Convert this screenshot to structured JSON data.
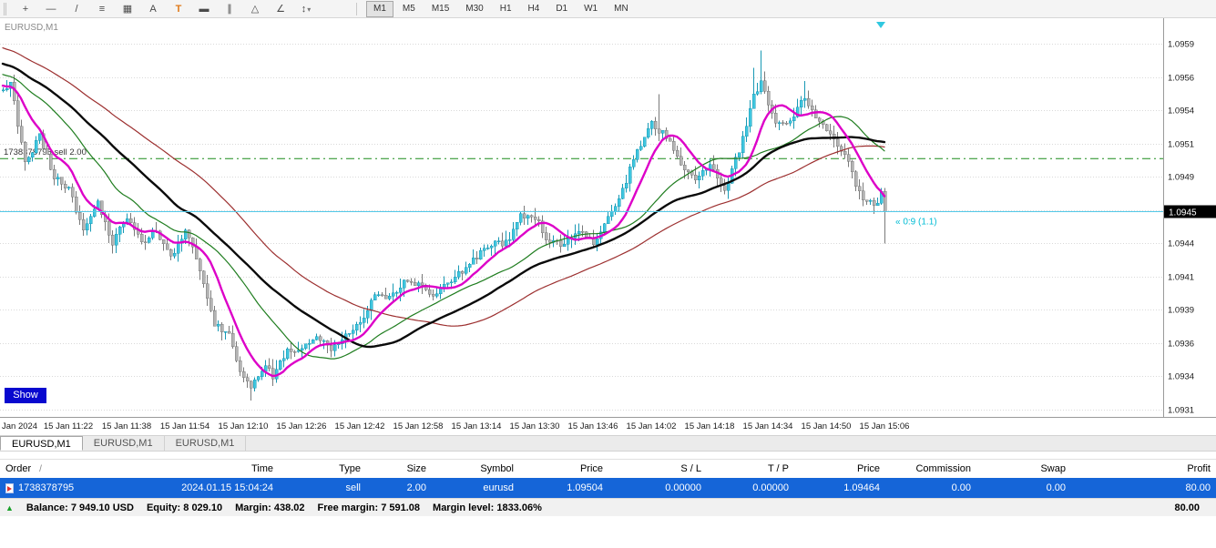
{
  "toolbar": {
    "tools": [
      {
        "name": "crosshair",
        "glyph": "+"
      },
      {
        "name": "horizontal-line",
        "glyph": "—"
      },
      {
        "name": "trendline",
        "glyph": "/"
      },
      {
        "name": "fibonacci",
        "glyph": "≡"
      },
      {
        "name": "grid",
        "glyph": "▦"
      },
      {
        "name": "text",
        "glyph": "A"
      },
      {
        "name": "text-label",
        "glyph": "T"
      },
      {
        "name": "rectangle",
        "glyph": "▬"
      },
      {
        "name": "equidistant-channel",
        "glyph": "∥"
      },
      {
        "name": "triangle",
        "glyph": "△"
      },
      {
        "name": "angle",
        "glyph": "∠"
      },
      {
        "name": "arrows",
        "glyph": "↕"
      }
    ],
    "dropdown_caret": "▾",
    "timeframes": [
      "M1",
      "M5",
      "M15",
      "M30",
      "H1",
      "H4",
      "D1",
      "W1",
      "MN"
    ],
    "active_timeframe": "M1"
  },
  "chart_data": {
    "type": "candlestick",
    "symbol": "EURUSD",
    "timeframe": "M1",
    "symbol_label": "EURUSD,M1",
    "show_button": "Show",
    "y_axis": {
      "values": [
        1.0959,
        1.09565,
        1.0954,
        1.09515,
        1.0949,
        1.09465,
        1.0944,
        1.09415,
        1.0939,
        1.09365,
        1.0934,
        1.09315
      ],
      "labels": [
        "1.0959",
        "1.0956",
        "1.0954",
        "1.0951",
        "1.0949",
        "1.0946",
        "1.0944",
        "1.0941",
        "1.0939",
        "1.0936",
        "1.0934",
        "1.0931"
      ]
    },
    "x_axis": {
      "labels": [
        {
          "m": 0,
          "text": "Jan 2024"
        },
        {
          "m": 18,
          "text": "15 Jan 11:22"
        },
        {
          "m": 34,
          "text": "15 Jan 11:38"
        },
        {
          "m": 50,
          "text": "15 Jan 11:54"
        },
        {
          "m": 66,
          "text": "15 Jan 12:10"
        },
        {
          "m": 82,
          "text": "15 Jan 12:26"
        },
        {
          "m": 98,
          "text": "15 Jan 12:42"
        },
        {
          "m": 114,
          "text": "15 Jan 12:58"
        },
        {
          "m": 130,
          "text": "15 Jan 13:14"
        },
        {
          "m": 146,
          "text": "15 Jan 13:30"
        },
        {
          "m": 162,
          "text": "15 Jan 13:46"
        },
        {
          "m": 178,
          "text": "15 Jan 14:02"
        },
        {
          "m": 194,
          "text": "15 Jan 14:18"
        },
        {
          "m": 210,
          "text": "15 Jan 14:34"
        },
        {
          "m": 226,
          "text": "15 Jan 14:50"
        },
        {
          "m": 242,
          "text": "15 Jan 15:06"
        }
      ]
    },
    "candle_count": 243,
    "price_path": [
      [
        0,
        1.09555
      ],
      [
        2,
        1.0956
      ],
      [
        6,
        1.095
      ],
      [
        10,
        1.0952
      ],
      [
        14,
        1.0949
      ],
      [
        18,
        1.0948
      ],
      [
        22,
        1.0945
      ],
      [
        26,
        1.0947
      ],
      [
        30,
        1.0944
      ],
      [
        34,
        1.0946
      ],
      [
        38,
        1.0944
      ],
      [
        42,
        1.0945
      ],
      [
        46,
        1.0943
      ],
      [
        50,
        1.0945
      ],
      [
        54,
        1.0942
      ],
      [
        58,
        1.0938
      ],
      [
        62,
        1.0937
      ],
      [
        64,
        1.0935
      ],
      [
        68,
        1.0933
      ],
      [
        72,
        1.0935
      ],
      [
        74,
        1.0934
      ],
      [
        78,
        1.0936
      ],
      [
        82,
        1.0936
      ],
      [
        86,
        1.0937
      ],
      [
        90,
        1.0936
      ],
      [
        94,
        1.0937
      ],
      [
        98,
        1.0938
      ],
      [
        102,
        1.094
      ],
      [
        106,
        1.094
      ],
      [
        110,
        1.0941
      ],
      [
        114,
        1.0941
      ],
      [
        118,
        1.094
      ],
      [
        122,
        1.0941
      ],
      [
        126,
        1.0942
      ],
      [
        130,
        1.0943
      ],
      [
        134,
        1.0944
      ],
      [
        138,
        1.0944
      ],
      [
        142,
        1.0946
      ],
      [
        146,
        1.0946
      ],
      [
        150,
        1.0944
      ],
      [
        154,
        1.0944
      ],
      [
        158,
        1.0945
      ],
      [
        162,
        1.0944
      ],
      [
        166,
        1.0946
      ],
      [
        170,
        1.0948
      ],
      [
        174,
        1.0951
      ],
      [
        178,
        1.0953
      ],
      [
        182,
        1.0952
      ],
      [
        186,
        1.095
      ],
      [
        190,
        1.0949
      ],
      [
        194,
        1.095
      ],
      [
        198,
        1.0948
      ],
      [
        202,
        1.0951
      ],
      [
        206,
        1.0955
      ],
      [
        208,
        1.0956
      ],
      [
        212,
        1.0953
      ],
      [
        216,
        1.0953
      ],
      [
        220,
        1.0955
      ],
      [
        224,
        1.0953
      ],
      [
        228,
        1.0952
      ],
      [
        232,
        1.095
      ],
      [
        236,
        1.0947
      ],
      [
        240,
        1.0947
      ],
      [
        241,
        1.0948
      ],
      [
        242,
        1.09464
      ]
    ],
    "overrides": [
      {
        "i": 68,
        "low": 1.09322
      },
      {
        "i": 180,
        "high": 1.09552
      },
      {
        "i": 206,
        "high": 1.09572
      },
      {
        "i": 208,
        "high": 1.09585
      },
      {
        "i": 220,
        "high": 1.09562
      },
      {
        "i": 242,
        "close": 1.09464,
        "low": 1.0944
      }
    ],
    "moving_averages": [
      {
        "name": "ma-slowest-red",
        "period": 70,
        "color": "#9c2f2f",
        "width": 1.2
      },
      {
        "name": "ma-slow-green",
        "period": 28,
        "color": "#1f7d1f",
        "width": 1.2
      },
      {
        "name": "ma-mid-black",
        "period": 45,
        "color": "#0a0a0a",
        "width": 2.4
      },
      {
        "name": "ma-fast-magenta",
        "period": 10,
        "color": "#dd00c8",
        "width": 2.4
      }
    ],
    "sell_line": {
      "price": 1.09504,
      "label": "1738378795 sell 2.00"
    },
    "bid": {
      "price": 1.09464,
      "tag": "1.0945"
    },
    "annotation": {
      "text": "« 0:9 (1.1)"
    },
    "colors": {
      "background": "#ffffff",
      "grid": "#d9d9d9",
      "axis": "#9a9a9a",
      "label": "#1a1a1a",
      "symbol_label": "#8a8a8a",
      "up_candle": "#3fc6df",
      "up_border": "#1899b4",
      "down_candle": "#b4b4b4",
      "down_border": "#7a7a7a",
      "sell_line": "#1a8c1a",
      "bid_line": "#53c9e8",
      "price_tag_bg": "#000000",
      "price_tag_text": "#ffffff",
      "annotation": "#00bcd4",
      "shift_marker": "#30c8e0"
    }
  },
  "tabs": [
    {
      "label": "EURUSD,M1",
      "active": true
    },
    {
      "label": "EURUSD,M1",
      "active": false
    },
    {
      "label": "EURUSD,M1",
      "active": false
    }
  ],
  "trade_table": {
    "selection_color": "#1565d8",
    "sort_indicator": "/",
    "columns": [
      "Order",
      "Time",
      "Type",
      "Size",
      "Symbol",
      "Price",
      "S / L",
      "T / P",
      "Price",
      "Commission",
      "Swap",
      "Profit"
    ],
    "row": [
      "1738378795",
      "2024.01.15 15:04:24",
      "sell",
      "2.00",
      "eurusd",
      "1.09504",
      "0.00000",
      "0.00000",
      "1.09464",
      "0.00",
      "0.00",
      "80.00"
    ]
  },
  "status_bar": {
    "icon_glyph": "▲",
    "segments": [
      "Balance: 7 949.10 USD",
      "Equity: 8 029.10",
      "Margin: 438.02",
      "Free margin: 7 591.08",
      "Margin level: 1833.06%"
    ],
    "profit": "80.00"
  }
}
